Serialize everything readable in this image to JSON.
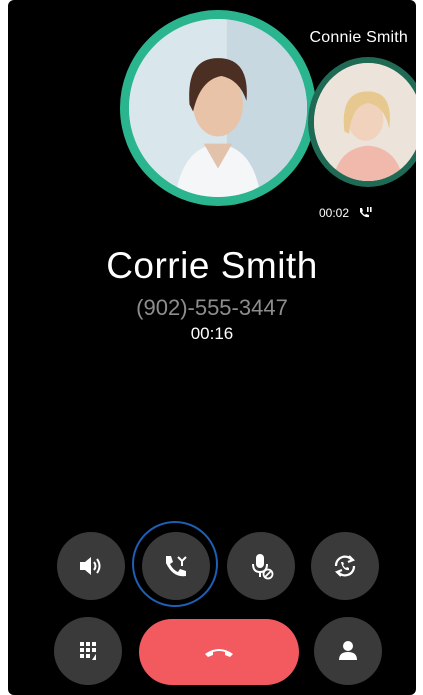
{
  "secondary_call": {
    "name": "Connie Smith",
    "duration": "00:02"
  },
  "active_call": {
    "name": "Corrie Smith",
    "number": "(902)-555-3447",
    "duration": "00:16"
  },
  "controls": {
    "row1": [
      "speaker-icon",
      "merge-call-icon",
      "mute-mic-icon",
      "swap-call-icon"
    ],
    "row2": [
      "dialpad-icon",
      "end-call-icon",
      "contact-icon"
    ]
  },
  "colors": {
    "accent_ring": "#2bb58f",
    "end_call": "#f25a5f",
    "focus_ring": "#1e5fb4",
    "button_bg": "#3a3a3a"
  }
}
